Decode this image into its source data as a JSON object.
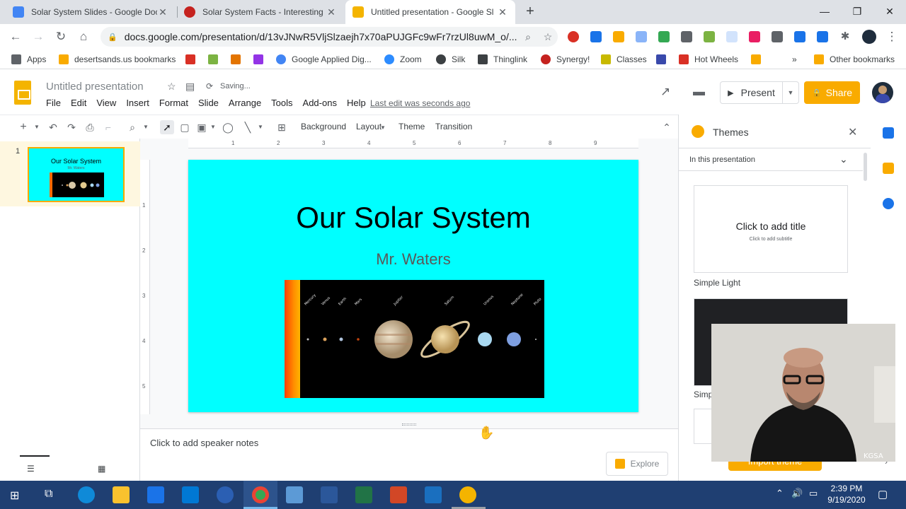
{
  "browser": {
    "tabs": [
      {
        "title": "Solar System Slides - Google Doc",
        "color": "#4285f4"
      },
      {
        "title": "Solar System Facts - Interesting F",
        "color": "#c5221f"
      },
      {
        "title": "Untitled presentation - Google Sl",
        "color": "#f4b400"
      }
    ],
    "url": "docs.google.com/presentation/d/13vJNwR5VljSlzaejh7x70aPUJGFc9wFr7rzUl8uwM_o/...",
    "window_controls": {
      "minimize": "—",
      "restore": "❐",
      "close": "✕"
    }
  },
  "bookmarks": [
    {
      "label": "Apps",
      "color": "#5f6368"
    },
    {
      "label": "desertsands.us bookmarks",
      "color": "#f9ab00"
    },
    {
      "label": "",
      "color": "#d93025"
    },
    {
      "label": "",
      "color": "#7cb342"
    },
    {
      "label": "",
      "color": "#e37400"
    },
    {
      "label": "",
      "color": "#9334e6"
    },
    {
      "label": "Google Applied Dig...",
      "color": "#4285f4"
    },
    {
      "label": "Zoom",
      "color": "#2d8cff"
    },
    {
      "label": "Silk",
      "color": "#3c4043"
    },
    {
      "label": "Thinglink",
      "color": "#3c4043"
    },
    {
      "label": "Synergy!",
      "color": "#c5221f"
    },
    {
      "label": "Classes",
      "color": "#c8b900"
    },
    {
      "label": "",
      "color": "#3949ab"
    },
    {
      "label": "Hot Wheels",
      "color": "#d93025"
    },
    {
      "label": "",
      "color": "#f9ab00"
    }
  ],
  "other_bookmarks": "Other bookmarks",
  "more_bookmarks": "»",
  "slides_app": {
    "doc_title": "Untitled presentation",
    "saving_status": "Saving...",
    "menus": [
      "File",
      "Edit",
      "View",
      "Insert",
      "Format",
      "Slide",
      "Arrange",
      "Tools",
      "Add-ons",
      "Help"
    ],
    "last_edit": "Last edit was seconds ago",
    "present_label": "Present",
    "share_label": "Share"
  },
  "edit_toolbar": {
    "background": "Background",
    "layout": "Layout",
    "theme": "Theme",
    "transition": "Transition"
  },
  "filmstrip": {
    "slide_number": "1",
    "thumb_title": "Our Solar System",
    "thumb_subtitle": "Mr. Waters"
  },
  "ruler": {
    "horizontal": [
      "1",
      "2",
      "3",
      "4",
      "5",
      "6",
      "7",
      "8",
      "9"
    ],
    "vertical": [
      "1",
      "2",
      "3",
      "4",
      "5"
    ]
  },
  "slide": {
    "title": "Our Solar System",
    "subtitle": "Mr. Waters",
    "background_color": "#00ffff"
  },
  "notes": {
    "placeholder": "Click to add speaker notes",
    "explore_label": "Explore"
  },
  "themes_panel": {
    "title": "Themes",
    "filter": "In this presentation",
    "cards": [
      {
        "name": "Simple Light",
        "preview_title": "Click to add title",
        "preview_subtitle": "Click to add subtitle"
      },
      {
        "name": "Simp"
      }
    ],
    "import_label": "Import theme"
  },
  "taskbar": {
    "time": "2:39 PM",
    "date": "9/19/2020"
  }
}
